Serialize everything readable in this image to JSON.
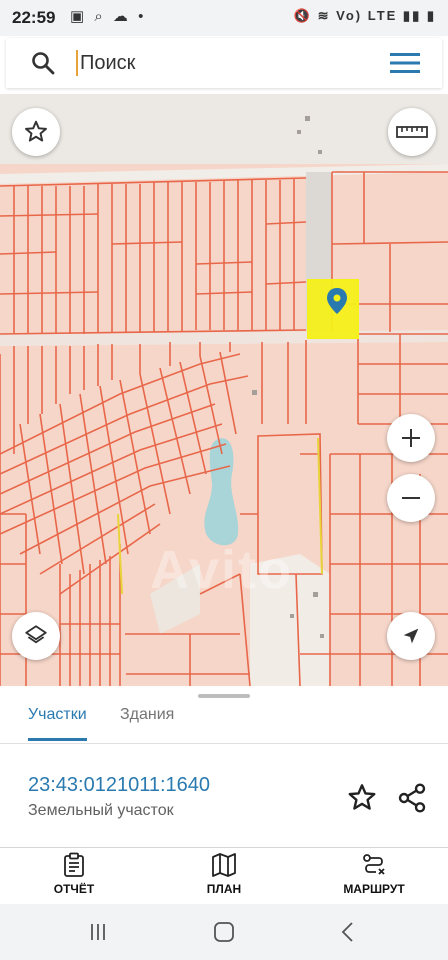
{
  "status_bar": {
    "time": "22:59",
    "left_icons": "▣ ⌕ ☁ •",
    "right_icons": "🔇 ≋ Vo) LTE ▮▮ ▮"
  },
  "search": {
    "placeholder": "Поиск",
    "value": ""
  },
  "map": {
    "watermark": "Avito",
    "parcel_fill": "#f6d6c9",
    "parcel_stroke": "#e8674a",
    "selection_color": "#f4f01a",
    "pin_color": "#2a7ab0",
    "water_color": "#a9d4d8"
  },
  "tabs": {
    "parcels": "Участки",
    "buildings": "Здания"
  },
  "parcel": {
    "cadastral_number": "23:43:0121011:1640",
    "type": "Земельный участок"
  },
  "actions": {
    "report": "ОТЧЁТ",
    "plan": "ПЛАН",
    "route": "МАРШРУТ"
  },
  "colors": {
    "accent": "#2a7ab0"
  }
}
